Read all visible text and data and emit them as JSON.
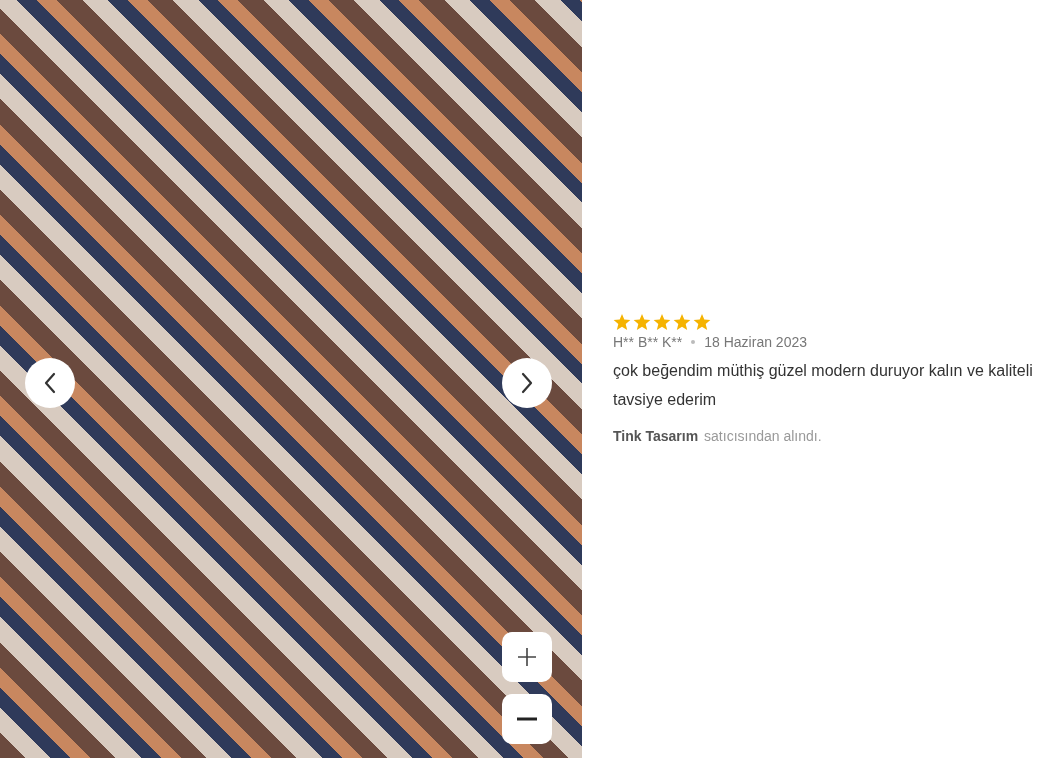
{
  "review": {
    "stars": 5,
    "author": "H** B** K**",
    "date": "18 Haziran 2023",
    "text": "çok beğendim müthiş güzel modern duruyor kalın ve kaliteli tavsiye ederim",
    "seller": "Tink Tasarım",
    "seller_note": "satıcısından alındı."
  }
}
